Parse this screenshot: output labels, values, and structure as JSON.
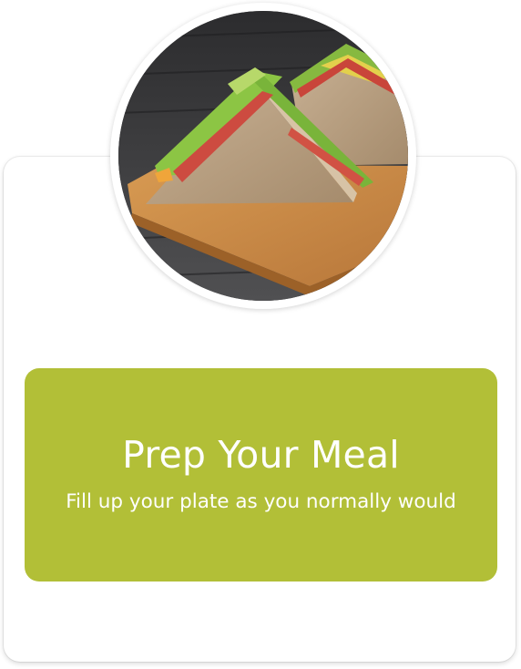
{
  "hero": {
    "image_icon": "sandwich-photo"
  },
  "banner": {
    "title": "Prep Your Meal",
    "subtitle": "Fill up your plate as you normally would",
    "background_color": "#b2bf37",
    "text_color": "#ffffff"
  }
}
